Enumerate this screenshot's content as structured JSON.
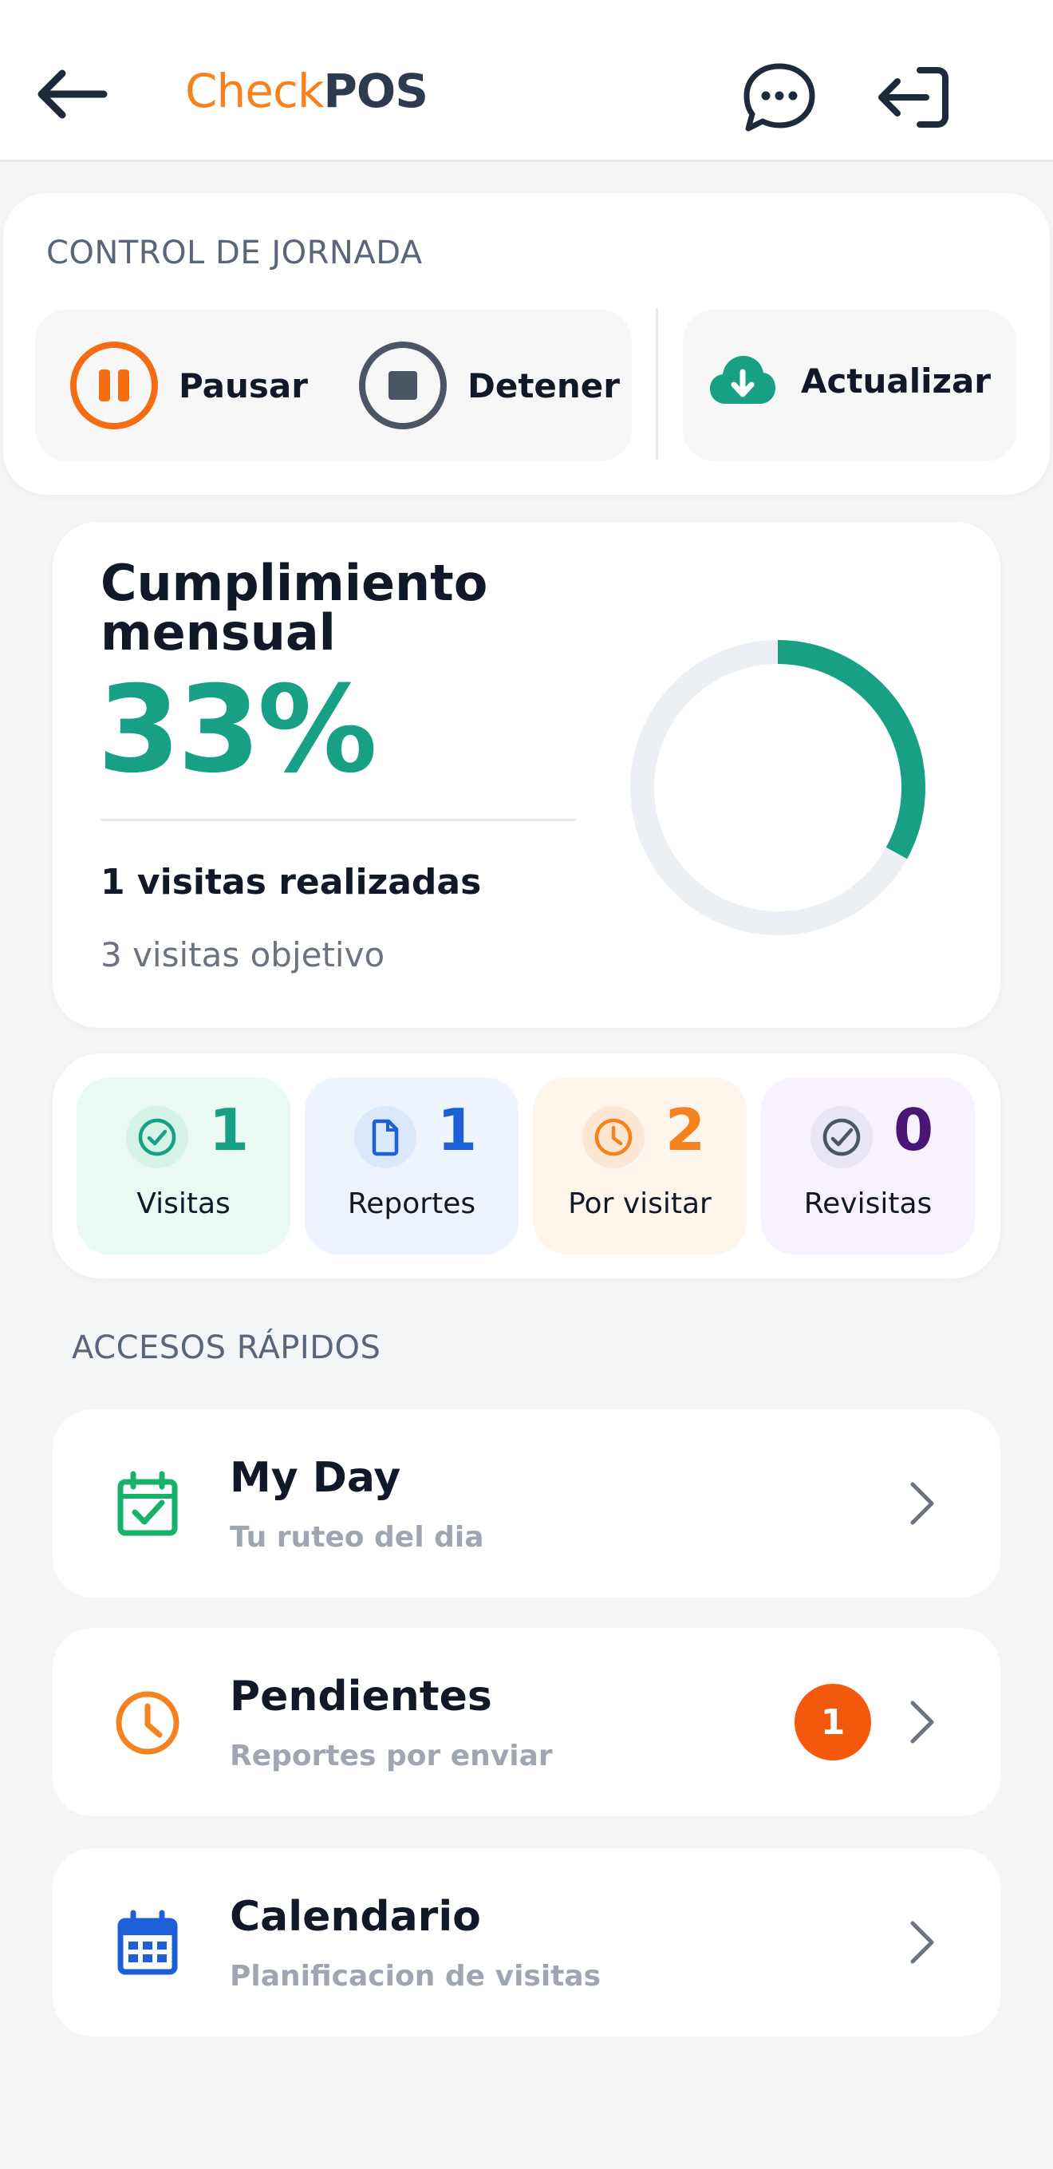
{
  "header": {
    "brand_part1": "Check",
    "brand_part2": "POS",
    "icons": [
      "arrow-left-icon",
      "chat-bubble-icon",
      "logout-icon"
    ]
  },
  "control": {
    "title": "CONTROL DE JORNADA",
    "pause_label": "Pausar",
    "stop_label": "Detener",
    "update_label": "Actualizar"
  },
  "cumplimiento": {
    "title_line1": "Cumplimiento",
    "title_line2": "mensual",
    "percent_text": "33%",
    "percent_value": 33,
    "realizadas": "1 visitas realizadas",
    "objetivo": "3 visitas objetivo",
    "ring_color": "#17a084",
    "track_color": "#eceff3"
  },
  "stats": [
    {
      "value": "1",
      "label": "Visitas",
      "color": "#17a084",
      "bg": "#eafaf3",
      "icon": "check-circle-icon"
    },
    {
      "value": "1",
      "label": "Reportes",
      "color": "#1d5fd6",
      "bg": "#edf4fe",
      "icon": "document-icon"
    },
    {
      "value": "2",
      "label": "Por visitar",
      "color": "#f5821f",
      "bg": "#fef6ed",
      "icon": "clock-icon"
    },
    {
      "value": "0",
      "label": "Revisitas",
      "color": "#4a1577",
      "bg": "#f7f2fd",
      "icon": "revisit-check-icon"
    }
  ],
  "accesos": {
    "title": "ACCESOS RÁPIDOS",
    "items": [
      {
        "title": "My Day",
        "subtitle": "Tu ruteo del dia",
        "icon": "calendar-check-icon"
      },
      {
        "title": "Pendientes",
        "subtitle": "Reportes por enviar",
        "icon": "clock-icon",
        "badge": "1"
      },
      {
        "title": "Calendario",
        "subtitle": "Planificacion de visitas",
        "icon": "calendar-grid-icon"
      }
    ]
  }
}
